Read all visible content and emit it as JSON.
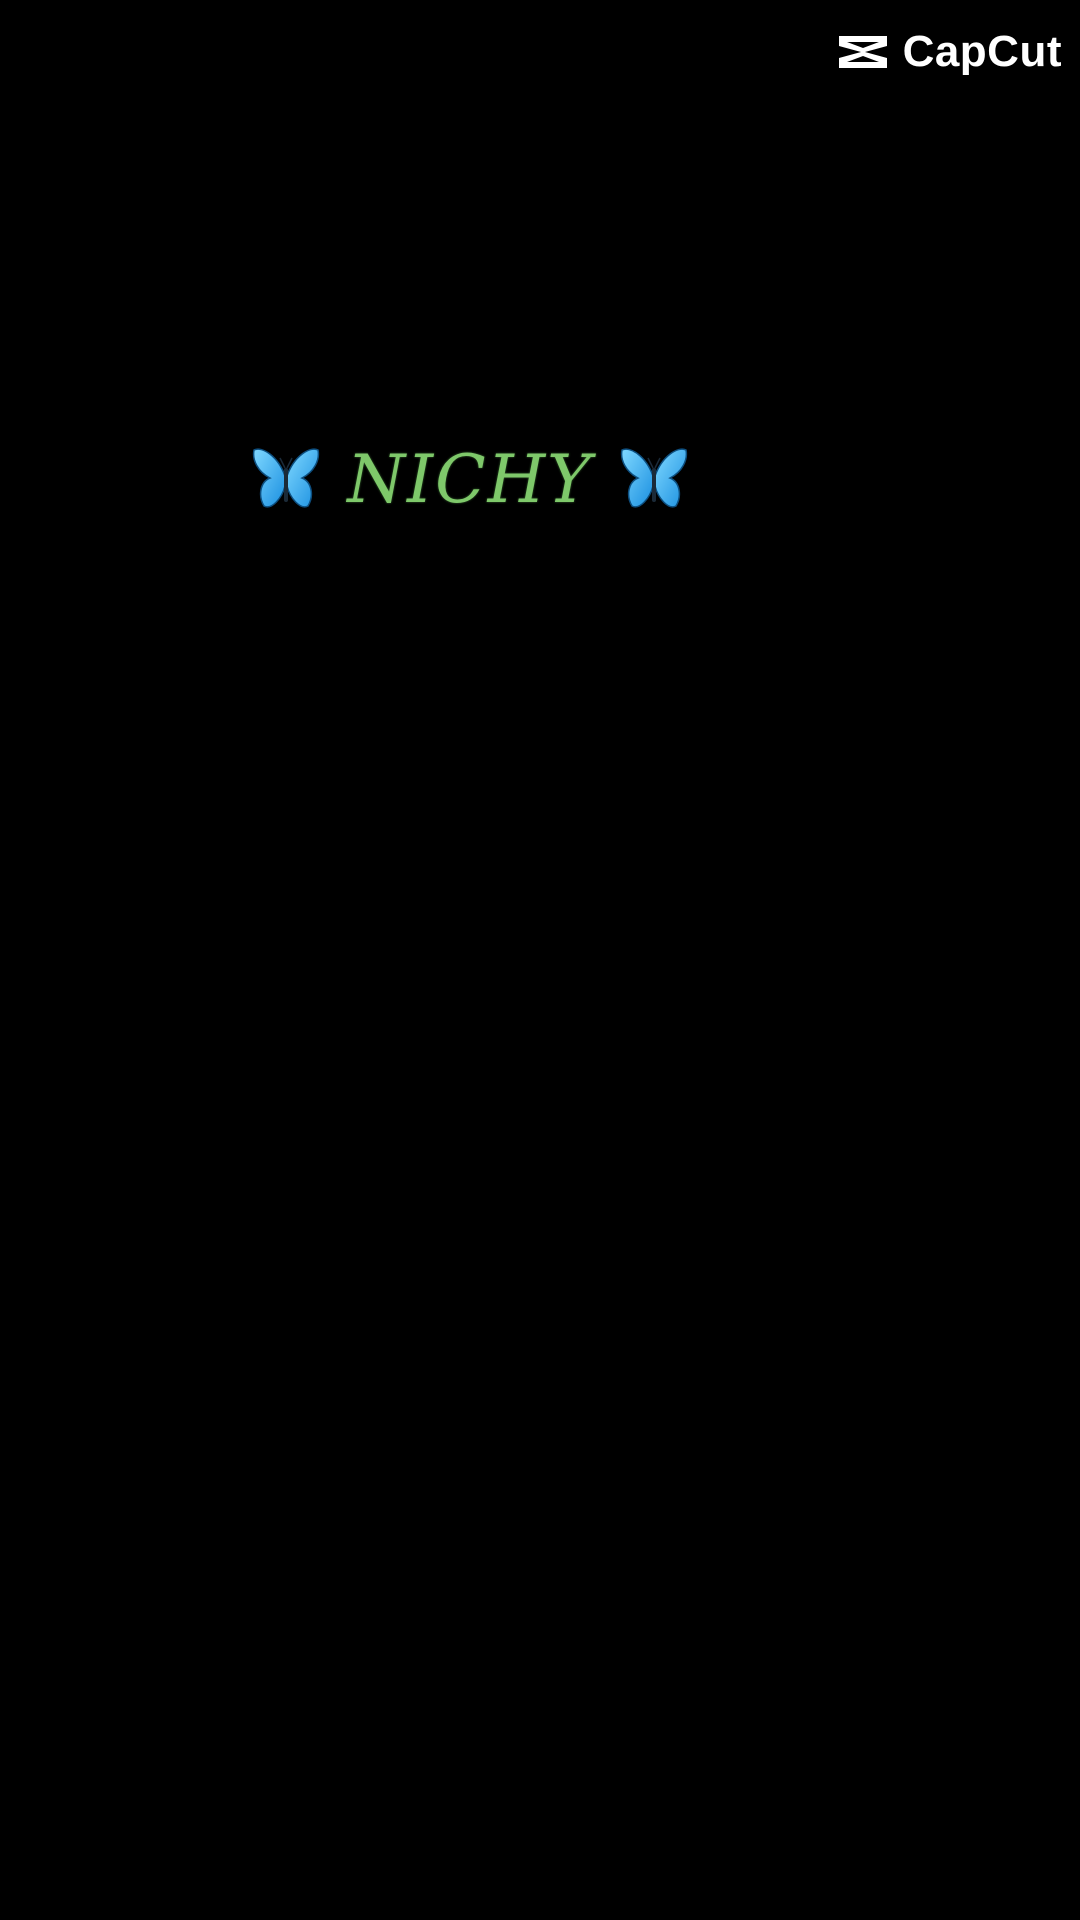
{
  "watermark": {
    "brand_text": "CapCut",
    "logo_icon": "capcut-logo-icon",
    "color": "#ffffff"
  },
  "overlay": {
    "title_text": "NICHY",
    "left_icon": "butterfly-icon",
    "right_icon": "butterfly-icon",
    "title_color": "#7ec86a",
    "butterfly_color": "#2fb4ff"
  },
  "background_color": "#000000"
}
